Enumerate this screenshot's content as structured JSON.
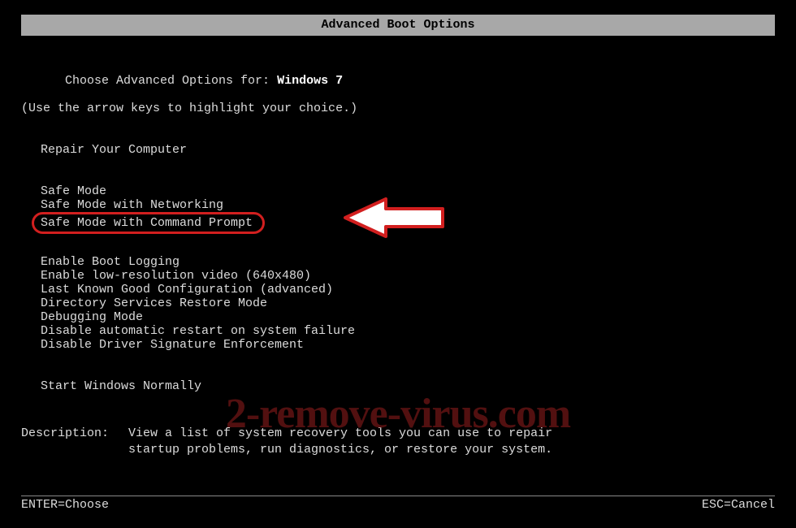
{
  "title": "Advanced Boot Options",
  "choose_prefix": "Choose Advanced Options for: ",
  "os_name": "Windows 7",
  "hint": "(Use the arrow keys to highlight your choice.)",
  "group_repair": {
    "item": "Repair Your Computer"
  },
  "group_safe": {
    "items": [
      "Safe Mode",
      "Safe Mode with Networking",
      "Safe Mode with Command Prompt"
    ],
    "highlighted_index": 2
  },
  "group_adv": {
    "items": [
      "Enable Boot Logging",
      "Enable low-resolution video (640x480)",
      "Last Known Good Configuration (advanced)",
      "Directory Services Restore Mode",
      "Debugging Mode",
      "Disable automatic restart on system failure",
      "Disable Driver Signature Enforcement"
    ]
  },
  "group_normal": {
    "item": "Start Windows Normally"
  },
  "description_label": "Description:",
  "description_text": "View a list of system recovery tools you can use to repair startup problems, run diagnostics, or restore your system.",
  "footer_left": "ENTER=Choose",
  "footer_right": "ESC=Cancel",
  "watermark": "2-remove-virus.com",
  "colors": {
    "accent": "#d21f1f"
  }
}
